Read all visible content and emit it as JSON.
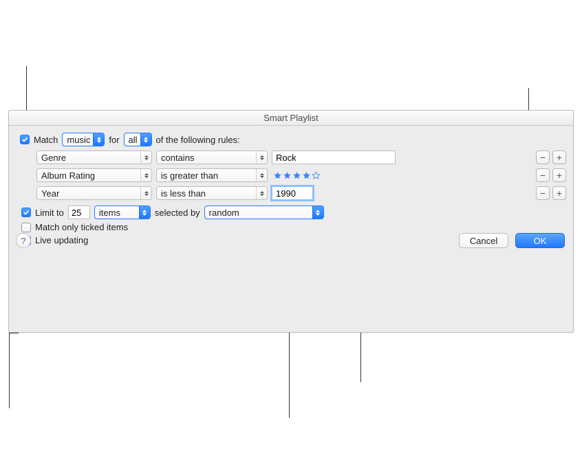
{
  "window": {
    "title": "Smart Playlist"
  },
  "match": {
    "checked": true,
    "label_match": "Match",
    "media_type": "music",
    "label_for": "for",
    "any_all": "all",
    "label_rest": "of the following rules:"
  },
  "rules": [
    {
      "field": "Genre",
      "op": "contains",
      "value": "Rock",
      "value_type": "text"
    },
    {
      "field": "Album Rating",
      "op": "is greater than",
      "value_type": "stars",
      "stars_filled": 4,
      "stars_total": 5
    },
    {
      "field": "Year",
      "op": "is less than",
      "value": "1990",
      "value_type": "text",
      "focused": true
    }
  ],
  "limit": {
    "checked": true,
    "label": "Limit to",
    "count": "25",
    "unit": "items",
    "selected_by_label": "selected by",
    "selected_by": "random"
  },
  "match_ticked": {
    "checked": false,
    "label": "Match only ticked items"
  },
  "live_updating": {
    "checked": true,
    "label": "Live updating"
  },
  "buttons": {
    "help": "?",
    "cancel": "Cancel",
    "ok": "OK",
    "minus": "−",
    "plus": "+"
  }
}
